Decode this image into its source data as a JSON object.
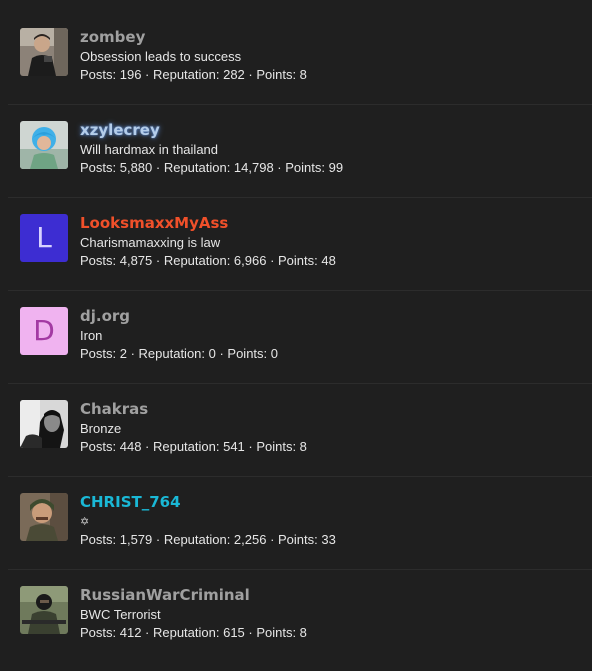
{
  "members": [
    {
      "username": "zombey",
      "user_title": "Obsession leads to success",
      "stats": "Posts: 196 · Reputation: 282 · Points: 8",
      "name_color": "#a0a0a0",
      "avatar_type": "photo"
    },
    {
      "username": "xzylecrey",
      "user_title": "Will hardmax in thailand",
      "stats": "Posts: 5,880 · Reputation: 14,798 · Points: 99",
      "name_color": "#b4cdea",
      "name_glow": "#5b86c8",
      "avatar_type": "photo"
    },
    {
      "username": "LooksmaxxMyAss",
      "user_title": "Charismamaxxing is law",
      "stats": "Posts: 4,875 · Reputation: 6,966 · Points: 48",
      "name_color": "#f0502a",
      "avatar_type": "letter",
      "avatar_letter": "L",
      "avatar_bg": "#3d2dd2",
      "avatar_fg": "#d8d2ff"
    },
    {
      "username": "dj.org",
      "user_title": "Iron",
      "stats": "Posts: 2 · Reputation: 0 · Points: 0",
      "name_color": "#a0a0a0",
      "avatar_type": "letter",
      "avatar_letter": "D",
      "avatar_bg": "#f0b3f0",
      "avatar_fg": "#a33aa3"
    },
    {
      "username": "Chakras",
      "user_title": "Bronze",
      "stats": "Posts: 448 · Reputation: 541 · Points: 8",
      "name_color": "#a0a0a0",
      "avatar_type": "photo"
    },
    {
      "username": "CHRIST_764",
      "user_title": "✡",
      "stats": "Posts: 1,579 · Reputation: 2,256 · Points: 33",
      "name_color": "#1ab8d6",
      "avatar_type": "photo"
    },
    {
      "username": "RussianWarCriminal",
      "user_title": "BWC Terrorist",
      "stats": "Posts: 412 · Reputation: 615 · Points: 8",
      "name_color": "#a0a0a0",
      "avatar_type": "photo"
    }
  ]
}
